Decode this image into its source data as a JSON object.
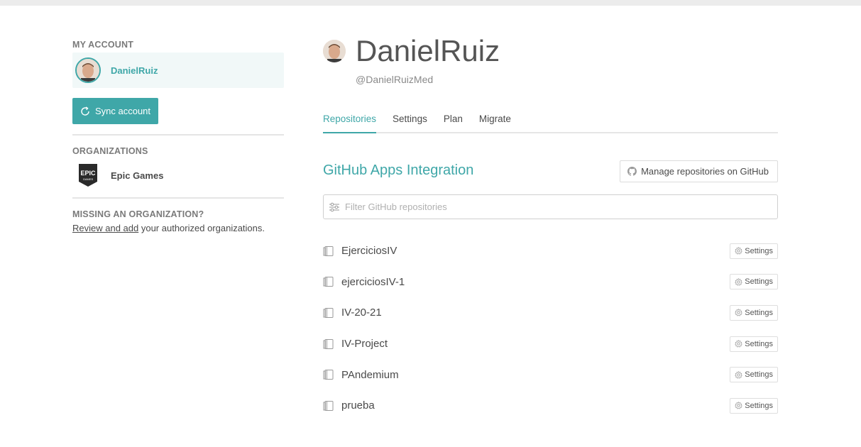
{
  "sidebar": {
    "my_account_heading": "MY ACCOUNT",
    "account_name": "DanielRuiz",
    "sync_label": "Sync account",
    "organizations_heading": "ORGANIZATIONS",
    "org_logo_text": [
      "EPIC",
      "GAMES"
    ],
    "org_name": "Epic Games",
    "missing_heading": "MISSING AN ORGANIZATION?",
    "missing_link": "Review and add",
    "missing_rest": " your authorized organizations."
  },
  "profile": {
    "name": "DanielRuiz",
    "handle": "@DanielRuizMed"
  },
  "tabs": [
    {
      "label": "Repositories",
      "active": true
    },
    {
      "label": "Settings",
      "active": false
    },
    {
      "label": "Plan",
      "active": false
    },
    {
      "label": "Migrate",
      "active": false
    }
  ],
  "integration": {
    "title": "GitHub Apps Integration",
    "manage_label": "Manage repositories on GitHub",
    "filter_placeholder": "Filter GitHub repositories"
  },
  "repos": [
    {
      "name": "EjerciciosIV",
      "settings_label": "Settings"
    },
    {
      "name": "ejerciciosIV-1",
      "settings_label": "Settings"
    },
    {
      "name": "IV-20-21",
      "settings_label": "Settings"
    },
    {
      "name": "IV-Project",
      "settings_label": "Settings"
    },
    {
      "name": "PAndemium",
      "settings_label": "Settings"
    },
    {
      "name": "prueba",
      "settings_label": "Settings"
    }
  ],
  "colors": {
    "accent": "#3fa7a8",
    "text": "#4a4a4a",
    "muted": "#8a8a8a"
  },
  "icons": {
    "sync": "sync-icon",
    "github": "github-icon",
    "filter": "filter-icon",
    "repo": "repo-icon",
    "gear": "gear-icon"
  }
}
